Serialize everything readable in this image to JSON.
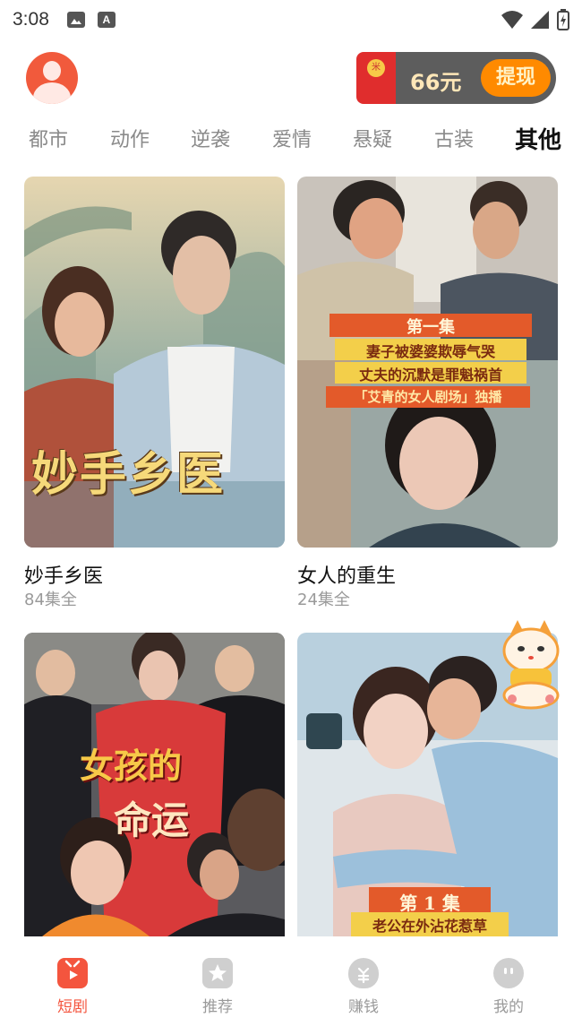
{
  "status_bar": {
    "time": "3:08",
    "notif_icon_a": "A"
  },
  "header": {
    "cash_amount": "66元",
    "withdraw_label": "提现",
    "envelope_mark": "米"
  },
  "tabs": [
    {
      "label": "都市",
      "active": false
    },
    {
      "label": "动作",
      "active": false
    },
    {
      "label": "逆袭",
      "active": false
    },
    {
      "label": "爱情",
      "active": false
    },
    {
      "label": "悬疑",
      "active": false
    },
    {
      "label": "古装",
      "active": false
    },
    {
      "label": "其他",
      "active": true
    }
  ],
  "dramas": [
    {
      "title": "妙手乡医",
      "episodes": "84集全",
      "poster_text": "妙手乡医"
    },
    {
      "title": "女人的重生",
      "episodes": "24集全",
      "poster_lines": [
        "第一集",
        "妻子被婆婆欺辱气哭",
        "丈夫的沉默是罪魁祸首",
        "「艾青的女人剧场」独播"
      ]
    },
    {
      "poster_lines": [
        "女孩的",
        "命运"
      ]
    },
    {
      "poster_lines": [
        "第 1 集",
        "老公在外沾花惹草"
      ]
    }
  ],
  "bottom_nav": [
    {
      "label": "短剧",
      "icon": "tv-icon",
      "active": true
    },
    {
      "label": "推荐",
      "icon": "star-icon",
      "active": false
    },
    {
      "label": "赚钱",
      "icon": "money-bag-icon",
      "active": false
    },
    {
      "label": "我的",
      "icon": "face-icon",
      "active": false
    }
  ],
  "colors": {
    "accent": "#f4553e",
    "cash_pill": "#5d5d5d",
    "withdraw_button": "#ff8a00"
  }
}
